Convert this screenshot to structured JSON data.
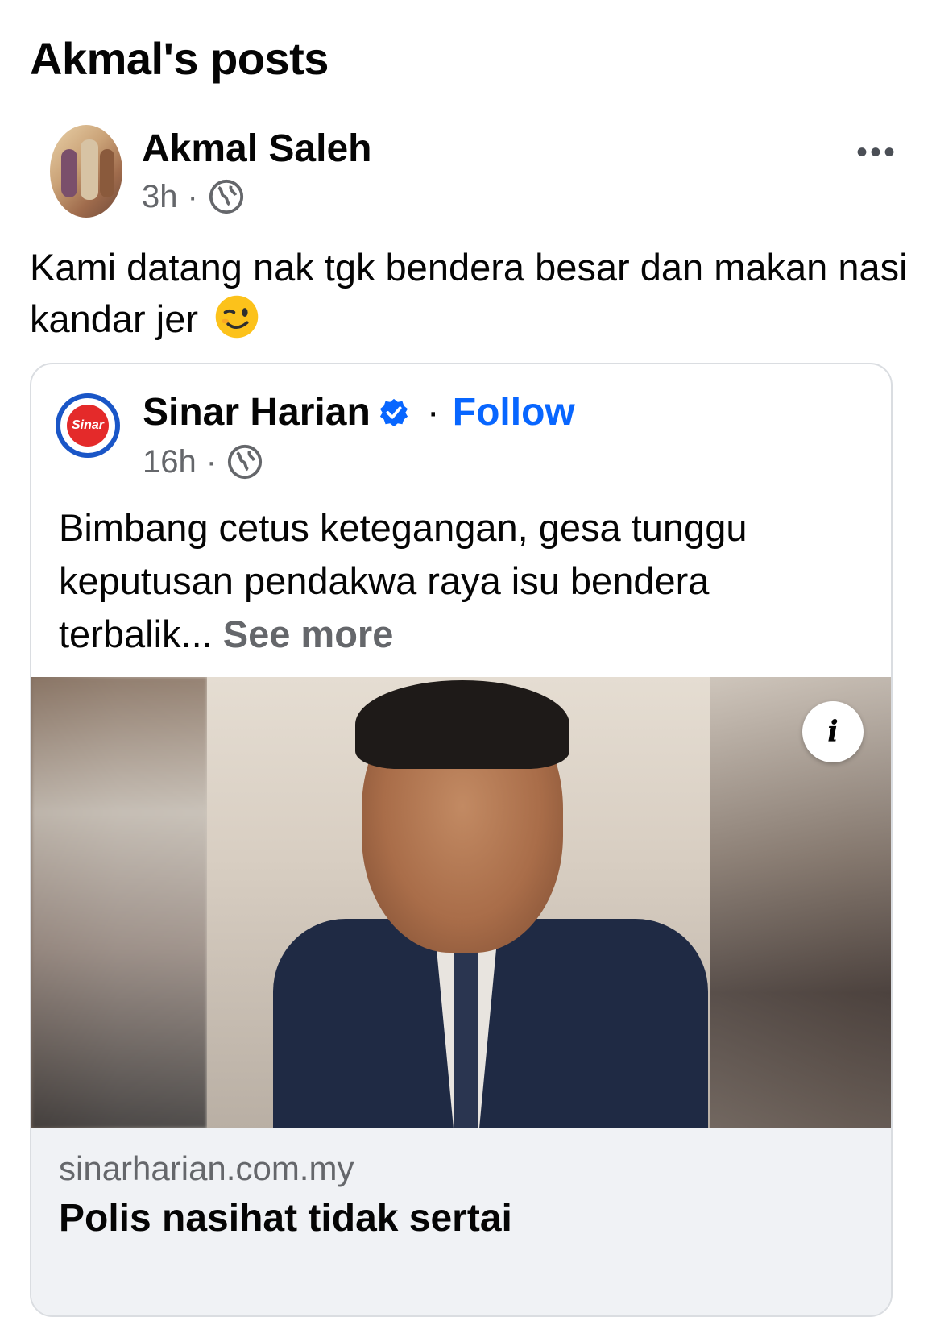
{
  "page": {
    "title": "Akmal's posts"
  },
  "post": {
    "author": "Akmal Saleh",
    "time": "3h",
    "separator": "·",
    "audience_icon": "globe-icon",
    "more_icon": "more-horizontal-icon",
    "more_label": "•••",
    "text": "Kami datang nak tgk bendera besar dan makan nasi kandar jer",
    "emoji": "winking-face-emoji"
  },
  "shared": {
    "page_name": "Sinar Harian",
    "verified_icon": "verified-badge-icon",
    "follow_label": "Follow",
    "separator": "·",
    "time": "16h",
    "audience_icon": "globe-icon",
    "logo_text": "Sinar",
    "text": "Bimbang cetus ketegangan, gesa tunggu keputusan pendakwa raya isu bendera terbalik...",
    "see_more": "See more",
    "info_label": "i",
    "link": {
      "domain": "sinarharian.com.my",
      "headline": "Polis nasihat tidak sertai"
    }
  },
  "colors": {
    "accent": "#0866ff",
    "secondary_text": "#65676b",
    "logo_red": "#e42a2a",
    "logo_blue": "#1a56c7"
  }
}
